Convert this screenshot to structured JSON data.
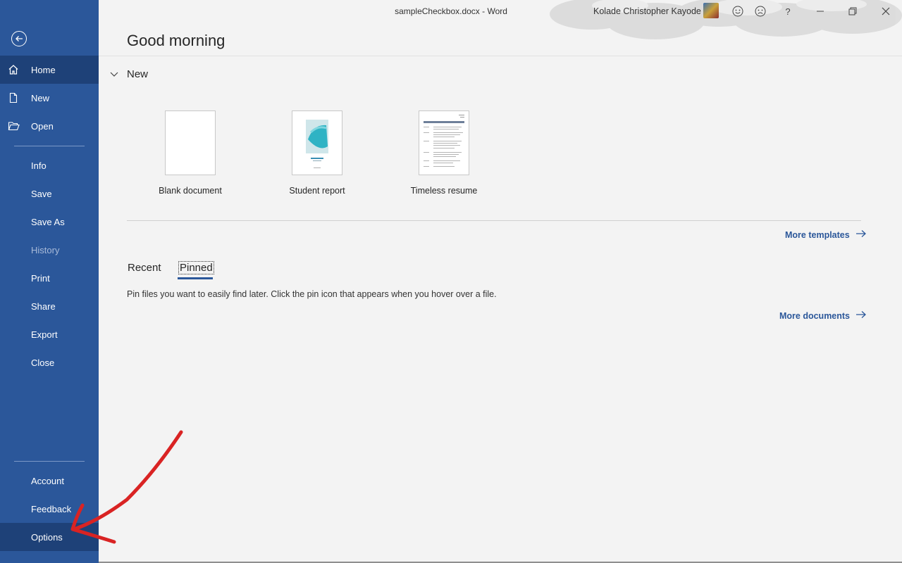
{
  "window": {
    "title": "sampleCheckbox.docx  -  Word",
    "user_name": "Kolade Christopher Kayode",
    "help_label": "?"
  },
  "sidebar": {
    "items": [
      {
        "label": "Home",
        "icon": "home-icon"
      },
      {
        "label": "New",
        "icon": "new-document-icon"
      },
      {
        "label": "Open",
        "icon": "folder-open-icon"
      },
      {
        "label": "Info"
      },
      {
        "label": "Save"
      },
      {
        "label": "Save As"
      },
      {
        "label": "History"
      },
      {
        "label": "Print"
      },
      {
        "label": "Share"
      },
      {
        "label": "Export"
      },
      {
        "label": "Close"
      },
      {
        "label": "Account"
      },
      {
        "label": "Feedback"
      },
      {
        "label": "Options"
      }
    ],
    "active_item": "Home",
    "highlighted_item": "Options",
    "disabled_item": "History"
  },
  "main": {
    "greeting": "Good morning",
    "new_section_title": "New",
    "templates": [
      {
        "name": "Blank document"
      },
      {
        "name": "Student report"
      },
      {
        "name": "Timeless resume"
      }
    ],
    "more_templates": "More templates",
    "tabs": [
      {
        "label": "Recent"
      },
      {
        "label": "Pinned"
      }
    ],
    "selected_tab": "Pinned",
    "pin_message": "Pin files you want to easily find later. Click the pin icon that appears when you hover over a file.",
    "more_documents": "More documents"
  },
  "colors": {
    "sidebar": "#2b579a",
    "sidebar_active": "#1e4178",
    "link": "#2b579a",
    "annotation": "#d92323"
  }
}
